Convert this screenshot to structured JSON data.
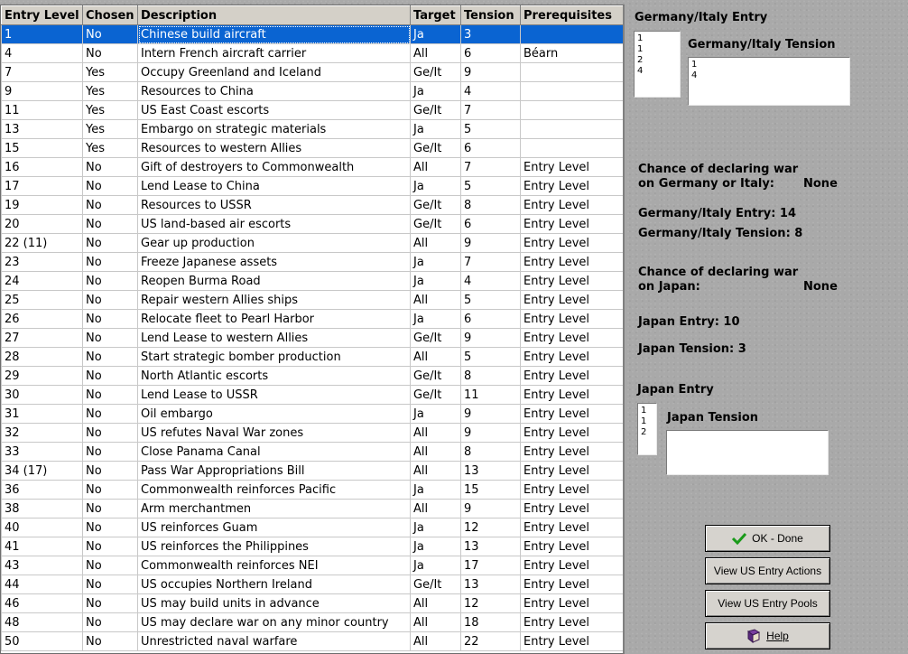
{
  "table": {
    "headers": [
      "Entry Level",
      "Chosen",
      "Description",
      "Target",
      "Tension",
      "Prerequisites"
    ],
    "rows": [
      [
        "1",
        "No",
        "Chinese build aircraft",
        "Ja",
        "3",
        ""
      ],
      [
        "4",
        "No",
        "Intern French aircraft carrier",
        "All",
        "6",
        "Béarn"
      ],
      [
        "7",
        "Yes",
        "Occupy Greenland and Iceland",
        "Ge/It",
        "9",
        ""
      ],
      [
        "9",
        "Yes",
        "Resources to China",
        "Ja",
        "4",
        ""
      ],
      [
        "11",
        "Yes",
        "US East Coast escorts",
        "Ge/It",
        "7",
        ""
      ],
      [
        "13",
        "Yes",
        "Embargo on strategic materials",
        "Ja",
        "5",
        ""
      ],
      [
        "15",
        "Yes",
        "Resources to western Allies",
        "Ge/It",
        "6",
        ""
      ],
      [
        "16",
        "No",
        "Gift of destroyers to Commonwealth",
        "All",
        "7",
        "Entry Level"
      ],
      [
        "17",
        "No",
        "Lend Lease to China",
        "Ja",
        "5",
        "Entry Level"
      ],
      [
        "19",
        "No",
        "Resources to USSR",
        "Ge/It",
        "8",
        "Entry Level"
      ],
      [
        "20",
        "No",
        "US land-based air escorts",
        "Ge/It",
        "6",
        "Entry Level"
      ],
      [
        "22 (11)",
        "No",
        "Gear up production",
        "All",
        "9",
        "Entry Level"
      ],
      [
        "23",
        "No",
        "Freeze Japanese assets",
        "Ja",
        "7",
        "Entry Level"
      ],
      [
        "24",
        "No",
        "Reopen Burma Road",
        "Ja",
        "4",
        "Entry Level"
      ],
      [
        "25",
        "No",
        "Repair western Allies ships",
        "All",
        "5",
        "Entry Level"
      ],
      [
        "26",
        "No",
        "Relocate fleet to Pearl Harbor",
        "Ja",
        "6",
        "Entry Level"
      ],
      [
        "27",
        "No",
        "Lend Lease to western Allies",
        "Ge/It",
        "9",
        "Entry Level"
      ],
      [
        "28",
        "No",
        "Start strategic bomber production",
        "All",
        "5",
        "Entry Level"
      ],
      [
        "29",
        "No",
        "North Atlantic escorts",
        "Ge/It",
        "8",
        "Entry Level"
      ],
      [
        "30",
        "No",
        "Lend Lease to USSR",
        "Ge/It",
        "11",
        "Entry Level"
      ],
      [
        "31",
        "No",
        "Oil embargo",
        "Ja",
        "9",
        "Entry Level"
      ],
      [
        "32",
        "No",
        "US refutes Naval War zones",
        "All",
        "9",
        "Entry Level"
      ],
      [
        "33",
        "No",
        "Close Panama Canal",
        "All",
        "8",
        "Entry Level"
      ],
      [
        "34 (17)",
        "No",
        "Pass War Appropriations Bill",
        "All",
        "13",
        "Entry Level"
      ],
      [
        "36",
        "No",
        "Commonwealth reinforces Pacific",
        "Ja",
        "15",
        "Entry Level"
      ],
      [
        "38",
        "No",
        "Arm merchantmen",
        "All",
        "9",
        "Entry Level"
      ],
      [
        "40",
        "No",
        "US reinforces Guam",
        "Ja",
        "12",
        "Entry Level"
      ],
      [
        "41",
        "No",
        "US reinforces the Philippines",
        "Ja",
        "13",
        "Entry Level"
      ],
      [
        "43",
        "No",
        "Commonwealth reinforces NEI",
        "Ja",
        "17",
        "Entry Level"
      ],
      [
        "44",
        "No",
        "US occupies Northern Ireland",
        "Ge/It",
        "13",
        "Entry Level"
      ],
      [
        "46",
        "No",
        "US may build units in advance",
        "All",
        "12",
        "Entry Level"
      ],
      [
        "48",
        "No",
        "US may declare war on any minor country",
        "All",
        "18",
        "Entry Level"
      ],
      [
        "50",
        "No",
        "Unrestricted naval warfare",
        "All",
        "22",
        "Entry Level"
      ]
    ],
    "selected_row": 0
  },
  "panel": {
    "ge_entry_title": "Germany/Italy Entry",
    "ge_entry_items": [
      "1",
      "1",
      "2",
      "4"
    ],
    "ge_tension_title": "Germany/Italy Tension",
    "ge_tension_items": [
      "1",
      "4"
    ],
    "chance_ge_line1": "Chance of declaring war",
    "chance_ge_line2": "on Germany or Italy:",
    "chance_ge_value": "None",
    "ge_entry_total": "Germany/Italy Entry: 14",
    "ge_tension_total": "Germany/Italy Tension: 8",
    "chance_ja_line1": "Chance of declaring war",
    "chance_ja_line2": "on Japan:",
    "chance_ja_value": "None",
    "ja_entry_total": "Japan Entry: 10",
    "ja_tension_total": "Japan Tension: 3",
    "ja_entry_title": "Japan Entry",
    "ja_entry_items": [
      "1",
      "1",
      "2"
    ],
    "ja_tension_title": "Japan Tension",
    "ja_tension_items": []
  },
  "buttons": {
    "ok": "OK - Done",
    "view_actions": "View US Entry Actions",
    "view_pools": "View US Entry Pools",
    "help": "Help"
  },
  "colors": {
    "selection": "#0a64d2",
    "ok_check": "#1a9a1a"
  }
}
